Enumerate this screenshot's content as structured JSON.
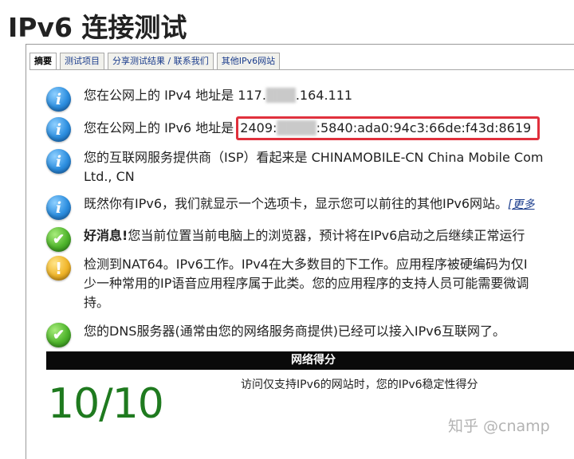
{
  "page": {
    "title": "IPv6 连接测试"
  },
  "tabs": [
    {
      "label": "摘要",
      "active": true
    },
    {
      "label": "测试项目",
      "active": false
    },
    {
      "label": "分享测试结果 / 联系我们",
      "active": false
    },
    {
      "label": "其他IPv6网站",
      "active": false
    }
  ],
  "results": {
    "ipv4": {
      "icon": "info-icon",
      "prefix": "您在公网上的 IPv4 地址是 117.",
      "masked": "███",
      "suffix": ".164.111"
    },
    "ipv6": {
      "icon": "info-icon",
      "prefix": "您在公网上的 IPv6 地址是 ",
      "addr_start": "2409:",
      "masked": "████",
      "addr_end": ":5840:ada0:94c3:66de:f43d:8619",
      "highlight_color": "#e0303c"
    },
    "isp": {
      "icon": "info-icon",
      "text": "您的互联网服务提供商（ISP）看起来是 CHINAMOBILE-CN China Mobile Com",
      "text2": "Ltd., CN"
    },
    "tab_note": {
      "icon": "info-icon",
      "text": "既然你有IPv6，我们就显示一个选项卡，显示您可以前往的其他IPv6网站。",
      "link": "[更多"
    },
    "good_news": {
      "icon": "check-icon",
      "bold": "好消息!",
      "text": "您当前位置当前电脑上的浏览器，预计将在IPv6启动之后继续正常运行"
    },
    "nat64": {
      "icon": "warning-icon",
      "line1": "检测到NAT64。IPv6工作。IPv4在大多数目的下工作。应用程序被硬编码为仅I",
      "line2": "少一种常用的IP语音应用程序属于此类。您的应用程序的支持人员可能需要微调",
      "line3": "持。"
    },
    "dns": {
      "icon": "check-icon",
      "text": "您的DNS服务器(通常由您的网络服务商提供)已经可以接入IPv6互联网了。"
    }
  },
  "score": {
    "header": "网络得分",
    "value": "10/10",
    "description": "访问仅支持IPv6的网站时，您的IPv6稳定性得分",
    "value_color": "#1f7a1f"
  },
  "watermark": "知乎 @cnamp",
  "colors": {
    "info": "#2d8fe0",
    "ok": "#4fb52c",
    "warn": "#f0b52a",
    "score_bar": "#0a0a0a"
  }
}
